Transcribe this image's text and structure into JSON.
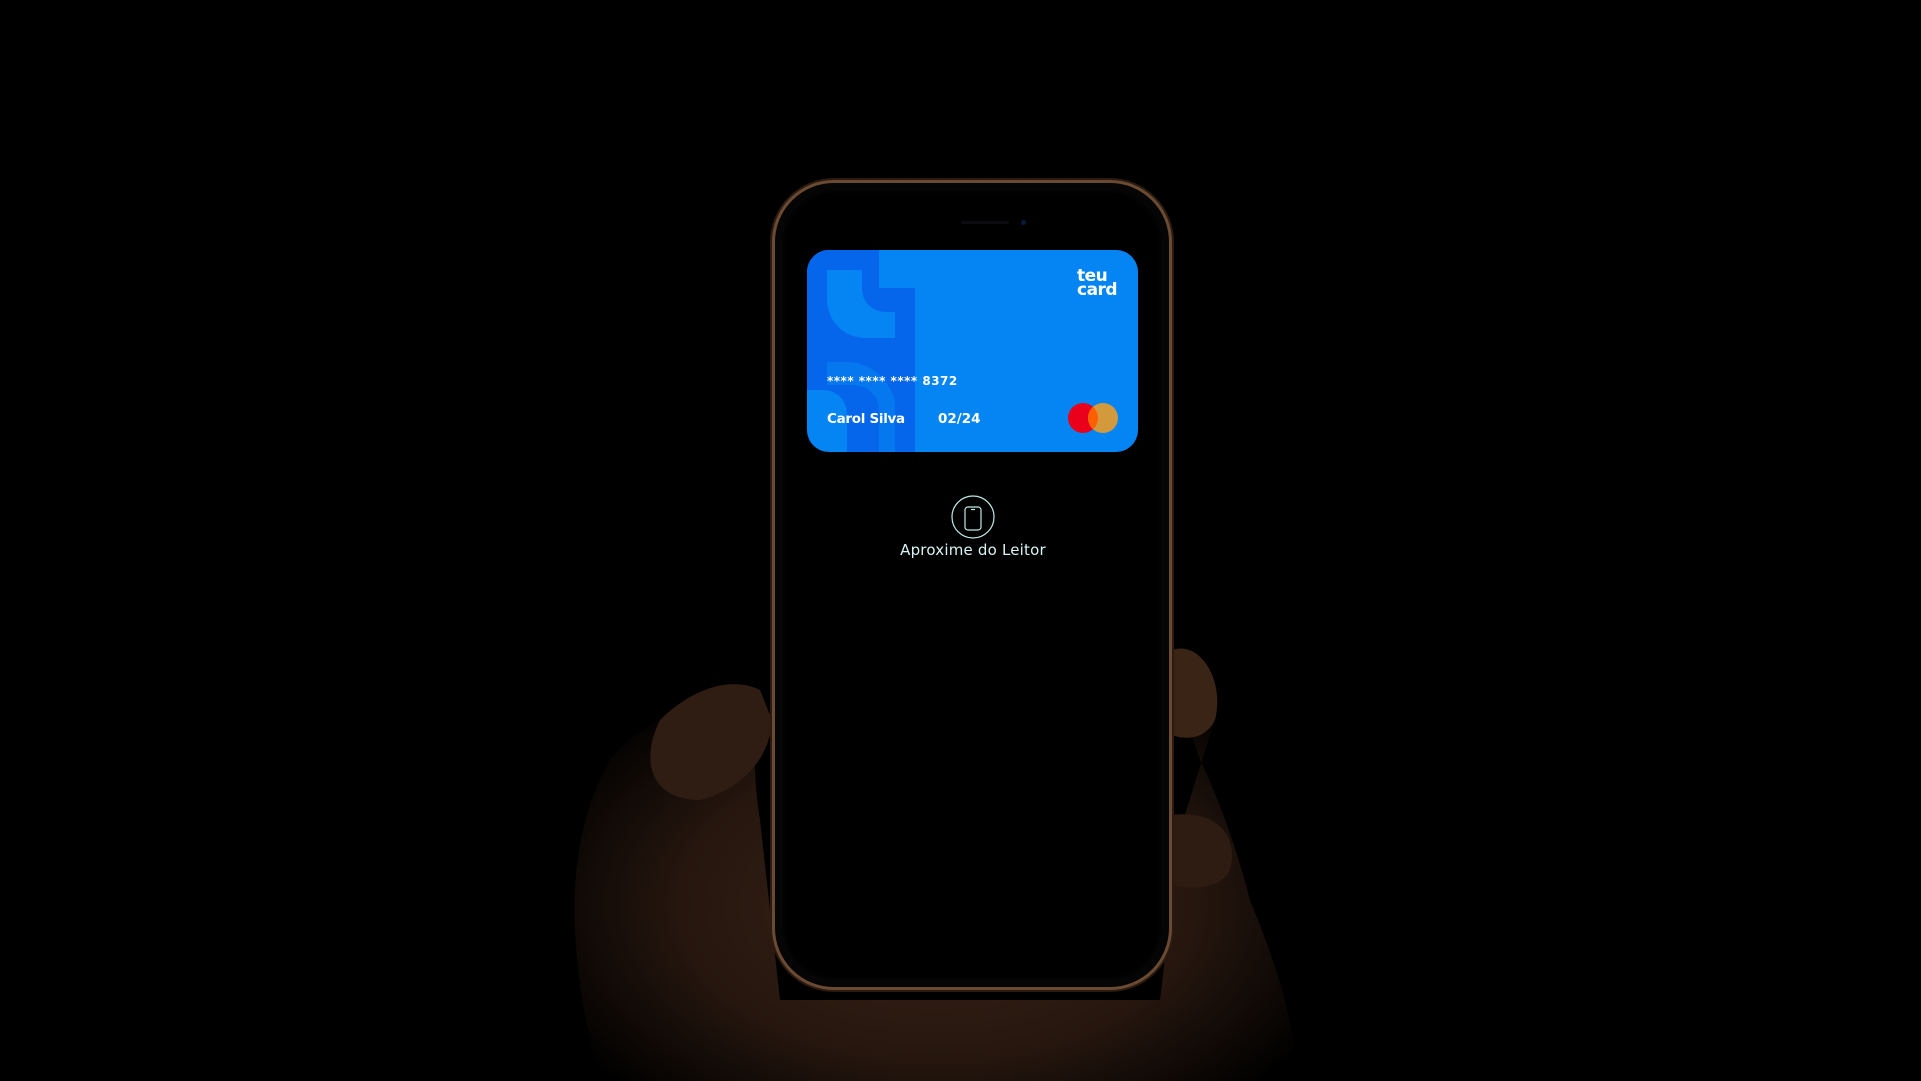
{
  "card": {
    "brand_logo": [
      "teu",
      "card"
    ],
    "number_masked": "**** **** **** 8372",
    "holder_name": "Carol Silva",
    "expiry": "02/24",
    "network_icon": "mastercard-logo",
    "color": "#0585f3"
  },
  "payment_prompt": {
    "icon": "phone-nfc-icon",
    "label": "Aproxime do Leitor"
  }
}
